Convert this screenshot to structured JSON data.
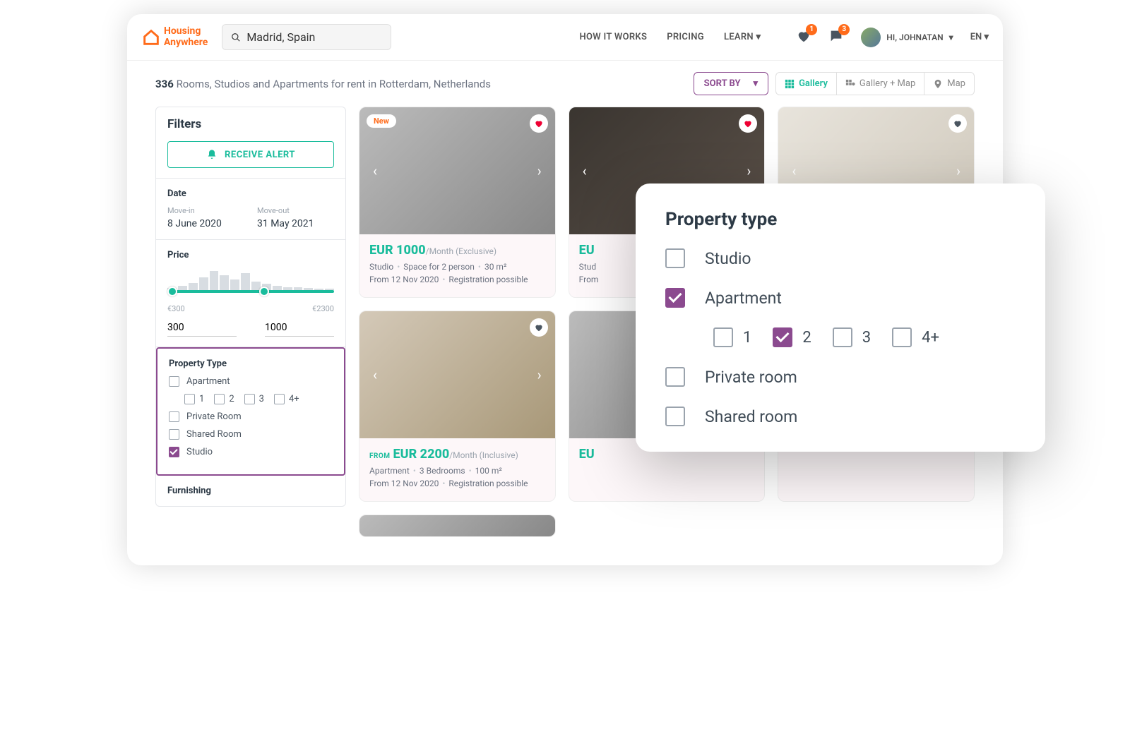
{
  "brand": {
    "line1": "Housing",
    "line2": "Anywhere"
  },
  "search": {
    "value": "Madrid, Spain"
  },
  "nav": {
    "how": "HOW IT WORKS",
    "pricing": "PRICING",
    "learn": "LEARN"
  },
  "badges": {
    "fav": "1",
    "msg": "3"
  },
  "user": {
    "greeting": "HI, JOHNATAN"
  },
  "lang": "EN",
  "results": {
    "count": "336",
    "tail": "Rooms, Studios and Apartments for rent in Rotterdam, Netherlands"
  },
  "sort": "SORT BY",
  "views": {
    "gallery": "Gallery",
    "gallerymap": "Gallery + Map",
    "map": "Map"
  },
  "filters": {
    "title": "Filters",
    "alert": "RECEIVE  ALERT",
    "date": {
      "section": "Date",
      "in_label": "Move-in",
      "out_label": "Move-out",
      "in": "8 June 2020",
      "out": "31 May 2021"
    },
    "price": {
      "section": "Price",
      "min_label": "€300",
      "max_label": "€2300",
      "min_val": "300",
      "max_val": "1000"
    },
    "prop": {
      "section": "Property Type",
      "apartment": "Apartment",
      "private": "Private Room",
      "shared": "Shared Room",
      "studio": "Studio",
      "o1": "1",
      "o2": "2",
      "o3": "3",
      "o4": "4+"
    },
    "furnishing": "Furnishing"
  },
  "cards": {
    "c1": {
      "new": "New",
      "price": "EUR 1000",
      "unit": "/Month (Exclusive)",
      "l1a": "Studio",
      "l1b": "Space for 2 person",
      "l1c": "30 m²",
      "l2a": "From 12 Nov 2020",
      "l2b": "Registration possible"
    },
    "c4": {
      "from": "FROM",
      "price": "EUR 2200",
      "unit": "/Month (Inclusive)",
      "l1a": "Apartment",
      "l1b": "3 Bedrooms",
      "l1c": "100 m²",
      "l2a": "From 12 Nov 2020",
      "l2b": "Registration possible"
    },
    "partial": {
      "p2": "EU",
      "p5": "EU",
      "p2b": "Stud",
      "p2c": "From"
    }
  },
  "popup": {
    "title": "Property type",
    "studio": "Studio",
    "apartment": "Apartment",
    "private": "Private room",
    "shared": "Shared room",
    "o1": "1",
    "o2": "2",
    "o3": "3",
    "o4": "4+"
  }
}
